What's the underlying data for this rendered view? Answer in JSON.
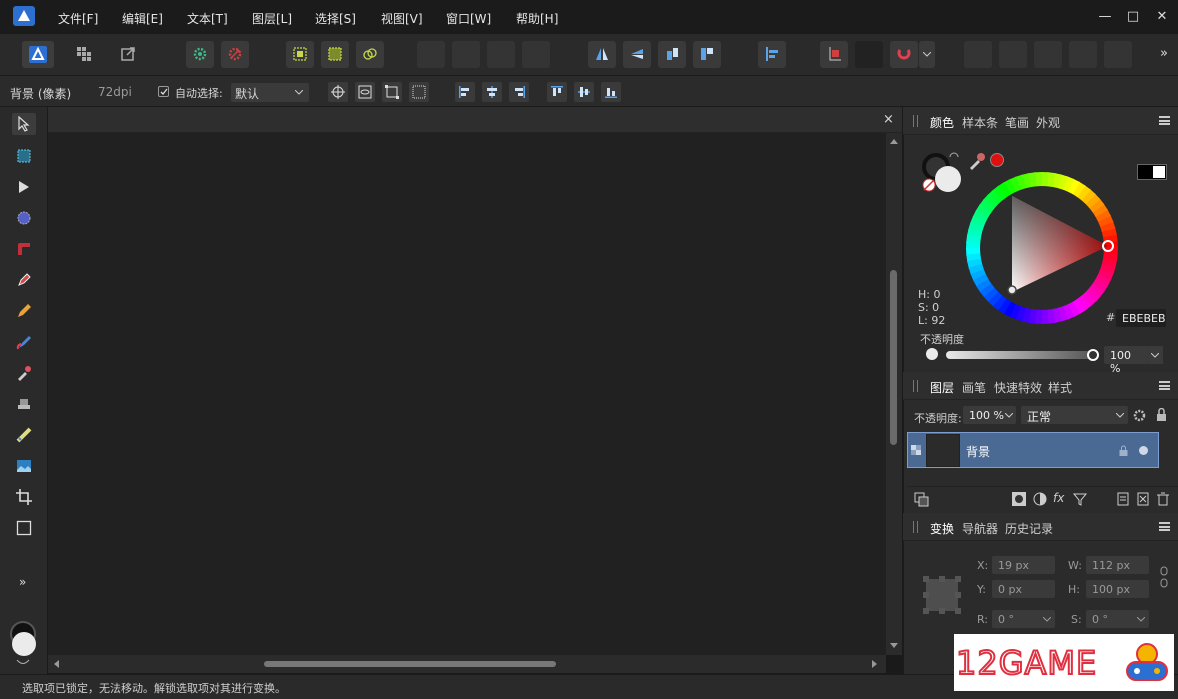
{
  "menu": {
    "items": [
      "文件[F]",
      "编辑[E]",
      "文本[T]",
      "图层[L]",
      "选择[S]",
      "视图[V]",
      "窗口[W]",
      "帮助[H]"
    ]
  },
  "window_controls": {
    "minimize": "—",
    "maximize": "□",
    "close": "✕"
  },
  "toolbar": {
    "overflow": "»"
  },
  "context": {
    "layer_name": "背景 (像素)",
    "dpi": "72dpi",
    "auto_select_label": "自动选择:",
    "auto_select_value": "默认"
  },
  "tools": {
    "expand": "»"
  },
  "document": {
    "close": "×"
  },
  "status": {
    "text": "选取项已锁定，无法移动。解锁选取项对其进行变换。"
  },
  "color_panel": {
    "tabs": [
      "颜色",
      "样本条",
      "笔画",
      "外观"
    ],
    "h": "H: 0",
    "s": "S: 0",
    "l": "L: 92",
    "hex_label": "#:",
    "hex_value": "EBEBEB",
    "opacity_label": "不透明度",
    "opacity_value": "100 %",
    "accent": "#e01010"
  },
  "layers_panel": {
    "tabs": [
      "图层",
      "画笔",
      "快速特效",
      "样式"
    ],
    "opacity_label": "不透明度:",
    "opacity_value": "100 %",
    "blend_mode": "正常",
    "layer_name": "背景",
    "selected_row_color": "#4a6a93"
  },
  "transform_panel": {
    "tabs": [
      "变换",
      "导航器",
      "历史记录"
    ],
    "x_label": "X:",
    "x_value": "19 px",
    "y_label": "Y:",
    "y_value": "0 px",
    "w_label": "W:",
    "w_value": "112 px",
    "h_label": "H:",
    "h_value": "100 px",
    "r_label": "R:",
    "r_value": "0 °",
    "s_label": "S:",
    "s_value": "0 °"
  },
  "watermark": {
    "text": "12GAME"
  }
}
